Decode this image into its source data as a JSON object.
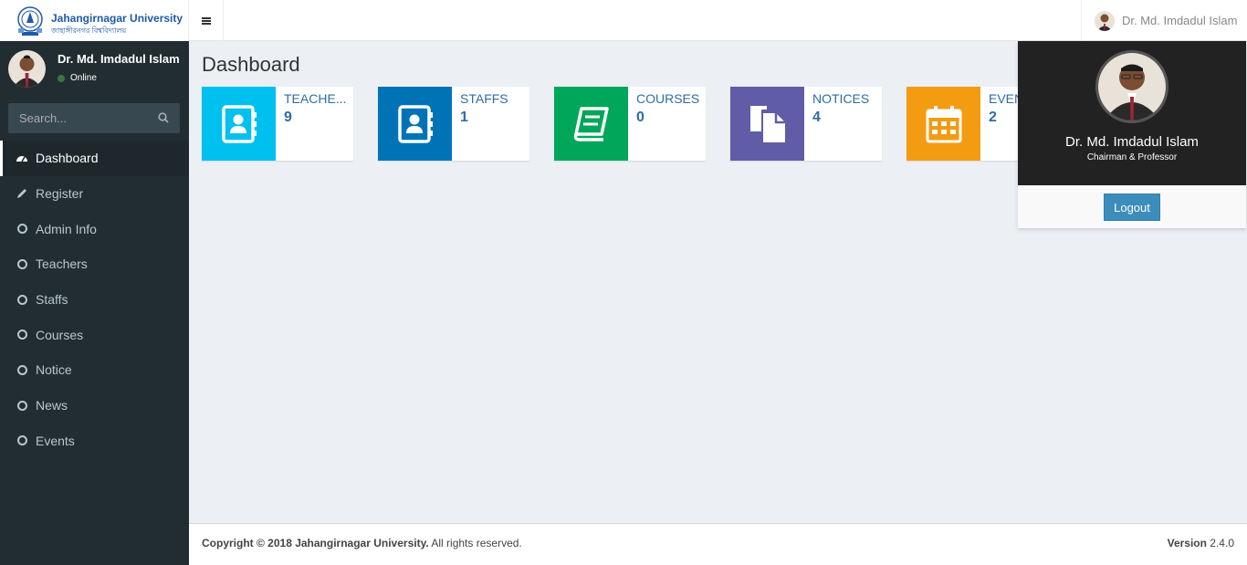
{
  "header": {
    "logo_title": "Jahangirnagar University",
    "logo_subtitle": "জাহাঙ্গীরনগর বিশ্ববিদ্যালয়",
    "user_name": "Dr. Md. Imdadul Islam"
  },
  "sidebar": {
    "user_name": "Dr. Md. Imdadul Islam",
    "status": "Online",
    "search_placeholder": "Search...",
    "items": [
      {
        "label": "Dashboard",
        "icon": "dashboard-icon"
      },
      {
        "label": "Register",
        "icon": "pencil-icon"
      },
      {
        "label": "Admin Info",
        "icon": "circle-icon"
      },
      {
        "label": "Teachers",
        "icon": "circle-icon"
      },
      {
        "label": "Staffs",
        "icon": "circle-icon"
      },
      {
        "label": "Courses",
        "icon": "circle-icon"
      },
      {
        "label": "Notice",
        "icon": "circle-icon"
      },
      {
        "label": "News",
        "icon": "circle-icon"
      },
      {
        "label": "Events",
        "icon": "circle-icon"
      }
    ]
  },
  "main": {
    "title": "Dashboard",
    "cards": [
      {
        "label": "TEACHE...",
        "value": "9",
        "color": "#00c0ef",
        "icon": "address-book-icon"
      },
      {
        "label": "STAFFS",
        "value": "1",
        "color": "#0073b7",
        "icon": "address-book-icon"
      },
      {
        "label": "COURSES",
        "value": "0",
        "color": "#00a65a",
        "icon": "book-icon"
      },
      {
        "label": "NOTICES",
        "value": "4",
        "color": "#605ca8",
        "icon": "files-icon"
      },
      {
        "label": "EVEN",
        "value": "2",
        "color": "#f39c12",
        "icon": "calendar-icon"
      }
    ]
  },
  "dropdown": {
    "name": "Dr. Md. Imdadul Islam",
    "role": "Chairman & Professor",
    "logout_label": "Logout"
  },
  "footer": {
    "copyright_bold": "Copyright © 2018 Jahangirnagar University.",
    "copyright_rest": " All rights reserved.",
    "version_label": "Version",
    "version_value": " 2.4.0"
  }
}
